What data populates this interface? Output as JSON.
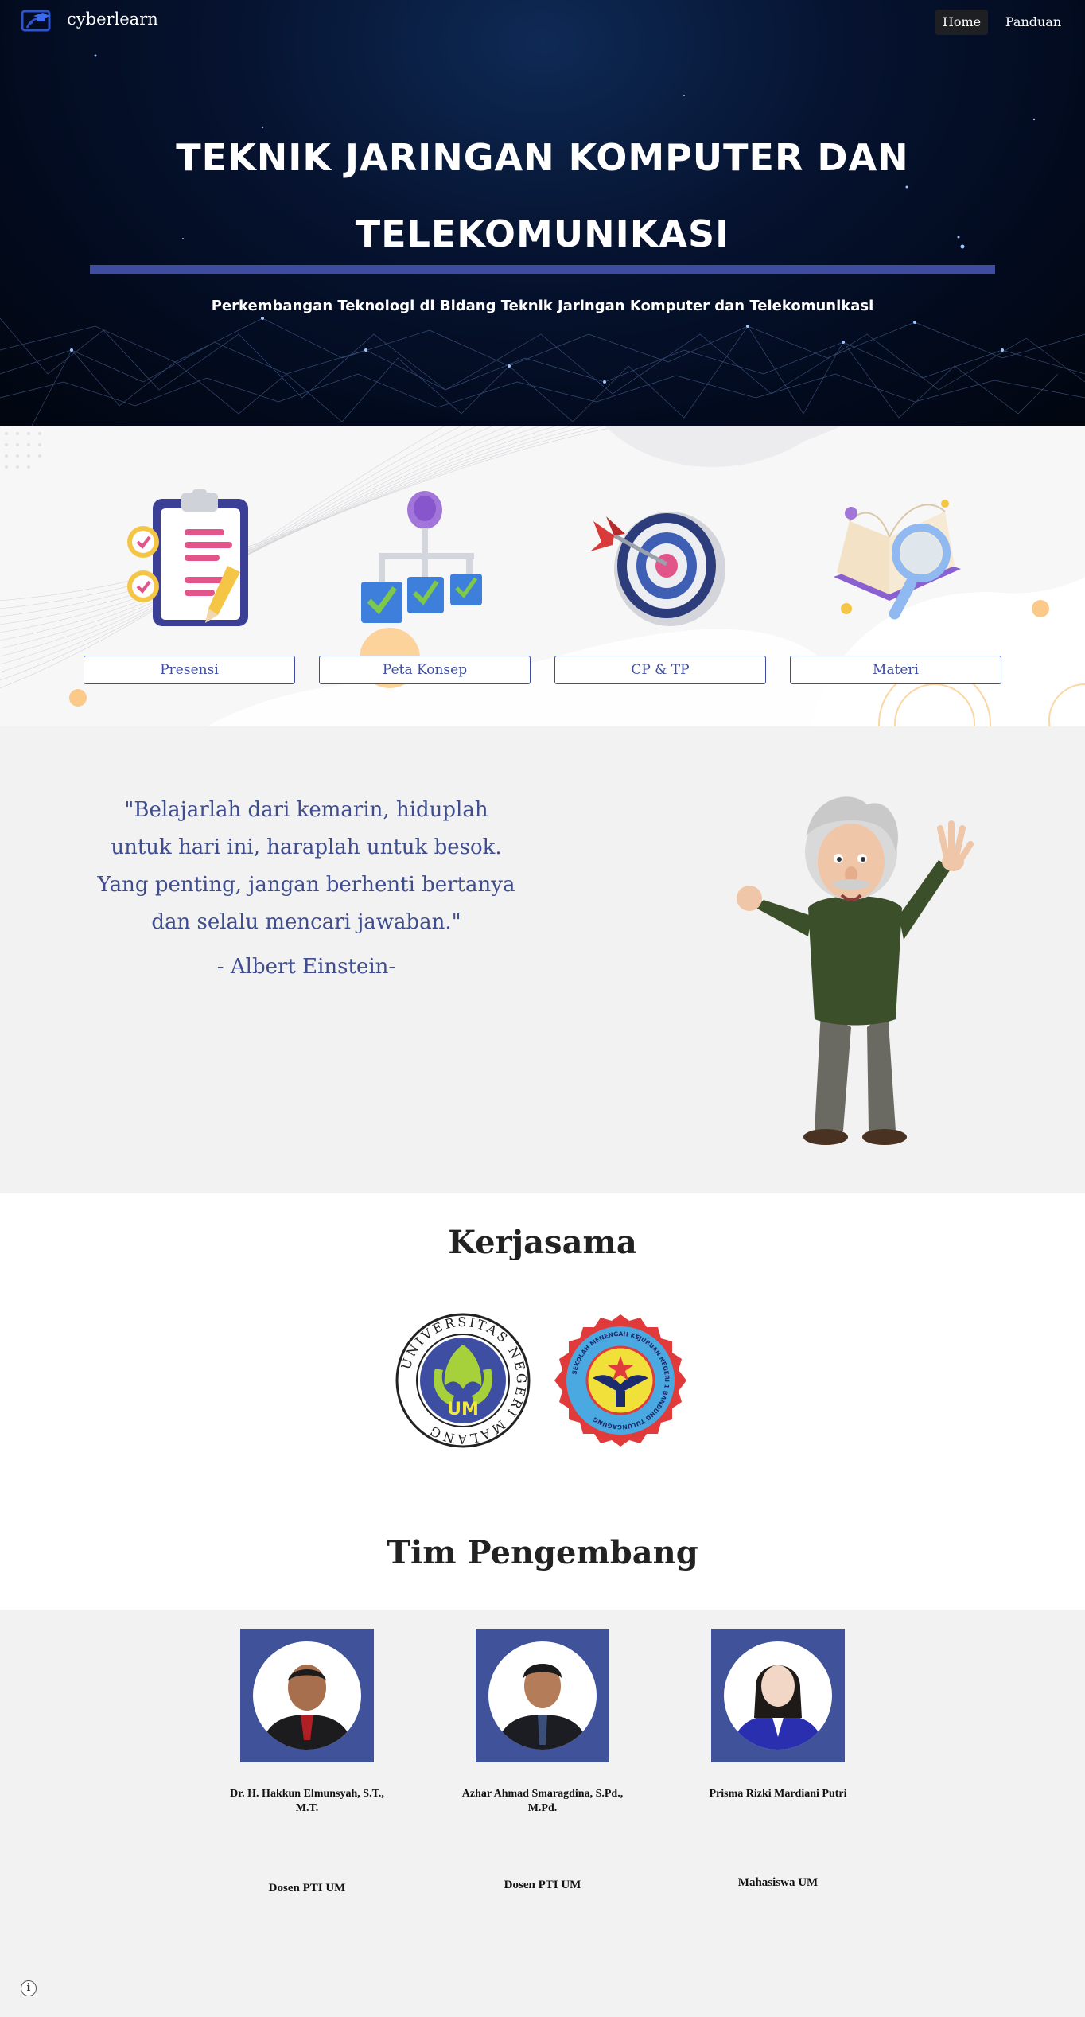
{
  "navbar": {
    "brand": "cyberlearn",
    "links": [
      {
        "label": "Home",
        "active": true
      },
      {
        "label": "Panduan",
        "active": false
      }
    ]
  },
  "hero": {
    "title_line1": "TEKNIK JARINGAN KOMPUTER DAN",
    "title_line2": "TELEKOMUNIKASI",
    "subtitle": "Perkembangan Teknologi di Bidang Teknik Jaringan Komputer dan Telekomunikasi",
    "accent_color": "#3f4da0"
  },
  "menu": [
    {
      "label": "Presensi",
      "icon": "clipboard-checklist-icon"
    },
    {
      "label": "Peta Konsep",
      "icon": "concept-map-icon"
    },
    {
      "label": "CP & TP",
      "icon": "target-dart-icon"
    },
    {
      "label": "Materi",
      "icon": "book-magnifier-icon"
    }
  ],
  "quote": {
    "text": "\"Belajarlah dari kemarin, hiduplah untuk hari ini, haraplah untuk besok. Yang penting, jangan berhenti bertanya dan selalu mencari jawaban.\"",
    "author": "- Albert Einstein-",
    "color": "#3f4d8f"
  },
  "kerjasama": {
    "title": "Kerjasama",
    "logos": [
      {
        "name": "universitas-negeri-malang-logo",
        "text": "UNIVERSITAS NEGERI MALANG",
        "center_text": "UM"
      },
      {
        "name": "smk-logo",
        "text": "SEKOLAH MENENGAH KEJURUAN NEGERI 1 BANDUNG TULUNGAGUNG"
      }
    ]
  },
  "team": {
    "title": "Tim Pengembang",
    "members": [
      {
        "name": "Dr. H. Hakkun Elmunsyah, S.T., M.T.",
        "role": "Dosen PTI UM"
      },
      {
        "name": "Azhar Ahmad Smaragdina, S.Pd., M.Pd.",
        "role": "Dosen PTI UM"
      },
      {
        "name": "Prisma Rizki Mardiani Putri",
        "role": "Mahasiswa UM"
      }
    ],
    "photo_bg": "#3f529a"
  },
  "footer": {
    "info_icon": "i"
  }
}
